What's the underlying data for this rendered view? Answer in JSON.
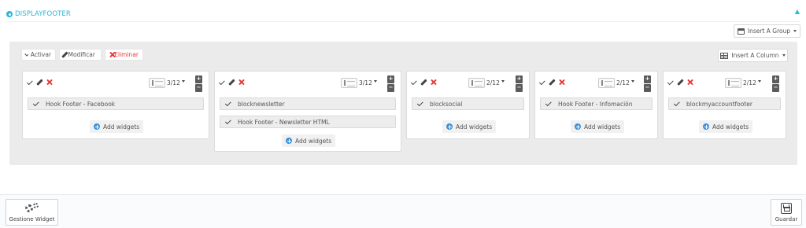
{
  "section": {
    "title": "DISPLAYFOOTER"
  },
  "toolbar": {
    "insert_group_label": "Insert A Group",
    "insert_column_label": "Insert A Column"
  },
  "actions": {
    "activate_label": "Activar",
    "modify_label": "Modificar",
    "delete_label": "Eliminar"
  },
  "columns": [
    {
      "width": "3/12",
      "widgets": [
        "Hook Footer - Facebook"
      ],
      "add_label": "Add widgets"
    },
    {
      "width": "3/12",
      "widgets": [
        "blocknewsletter",
        "Hook Footer - Newsletter HTML"
      ],
      "add_label": "Add widgets"
    },
    {
      "width": "2/12",
      "widgets": [
        "blocksocial"
      ],
      "add_label": "Add widgets"
    },
    {
      "width": "2/12",
      "widgets": [
        "Hook Footer - Infomación"
      ],
      "add_label": "Add widgets"
    },
    {
      "width": "2/12",
      "widgets": [
        "blockmyaccountfooter"
      ],
      "add_label": "Add widgets"
    }
  ],
  "footer": {
    "manage_widget_label": "Gestione Widget",
    "save_label": "Guardar"
  },
  "colors": {
    "accent": "#25b9d7",
    "danger": "#e53935",
    "add_icon": "#3b8fd8",
    "workspace": "#ebebeb"
  }
}
